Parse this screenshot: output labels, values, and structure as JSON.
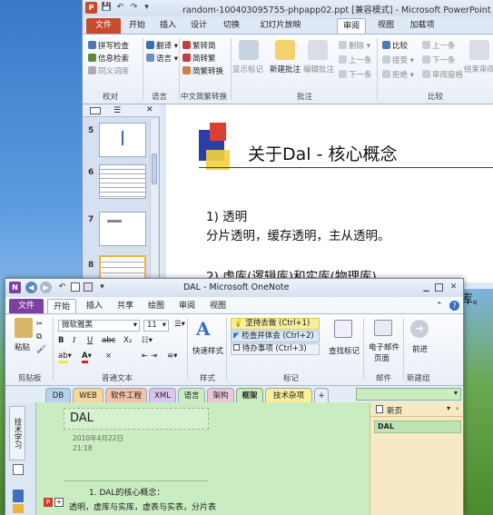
{
  "powerpoint": {
    "title": "random-100403095755-phpapp02.ppt [兼容模式] - Microsoft PowerPoint",
    "qat": {
      "save": "💾",
      "undo": "↶",
      "redo": "↷",
      "more": "▾"
    },
    "tabs": [
      "文件",
      "开始",
      "插入",
      "设计",
      "切换",
      "幻灯片放映",
      "审阅",
      "视图",
      "加载项"
    ],
    "active_tab": "审阅",
    "groups": {
      "proofing": {
        "label": "校对",
        "items": [
          "拼写检查",
          "信息检索",
          "同义词库"
        ]
      },
      "language": {
        "label": "语言",
        "items": [
          "翻译",
          "语言"
        ]
      },
      "chinese": {
        "label": "中文简繁转换",
        "items": [
          "繁转简",
          "简转繁",
          "简繁转换"
        ]
      },
      "comments": {
        "label": "批注",
        "items": [
          "显示标记",
          "新建批注",
          "编辑批注",
          "删除",
          "上一条",
          "下一条"
        ]
      },
      "compare": {
        "label": "比较",
        "items": [
          "比较",
          "接受",
          "拒绝",
          "上一条",
          "下一条",
          "审阅窗格",
          "结束审阅"
        ]
      }
    },
    "slides": [
      {
        "num": "5"
      },
      {
        "num": "6"
      },
      {
        "num": "7"
      },
      {
        "num": "8"
      }
    ],
    "slide": {
      "title": "关于Dal - 核心概念",
      "line1": "1) 透明",
      "line2": "分片透明，缓存透明，主从透明。",
      "line3": "2) 虚库(逻辑库)和实库(物理库)",
      "line3_tail": "库。"
    }
  },
  "onenote": {
    "title": "DAL - Microsoft OneNote",
    "tabs": [
      "文件",
      "开始",
      "插入",
      "共享",
      "绘图",
      "审阅",
      "视图"
    ],
    "active_tab": "开始",
    "clipboard": {
      "paste": "粘贴",
      "label": "剪贴板"
    },
    "font": {
      "family": "微软雅黑",
      "size": "11",
      "bold": "B",
      "italic": "I",
      "underline": "U",
      "strike": "abc",
      "sub": "X₂",
      "label": "普通文本"
    },
    "styles": {
      "quick": "快速样式",
      "label": "样式"
    },
    "tags": {
      "items": [
        "坚持去做 (Ctrl+1)",
        "检查并体会 (Ctrl+2)",
        "待办事项 (Ctrl+3)"
      ],
      "find": "查找标记",
      "label": "标记"
    },
    "email": {
      "text1": "电子邮件",
      "text2": "页面",
      "label": "邮件"
    },
    "new": {
      "text": "前进",
      "label": "新建组"
    },
    "sections": [
      "DB",
      "WEB",
      "软件工程",
      "XML",
      "语言",
      "架构",
      "框架",
      "技术杂项",
      "+"
    ],
    "active_section": "框架",
    "left_label": "技术学习",
    "page": {
      "title": "DAL",
      "date": "2010年4月22日",
      "time": "21:18",
      "line1": "1.   DAL的核心概念：",
      "line2": "透明，虚库与实库，虚表与实表，分片表"
    },
    "pagelist": {
      "new_page": "新页",
      "items": [
        "DAL"
      ]
    }
  },
  "colors": {
    "accent": "#c64a2c",
    "onenote_accent": "#7d3fa0",
    "tab_file_one": "#7d3fa0"
  }
}
